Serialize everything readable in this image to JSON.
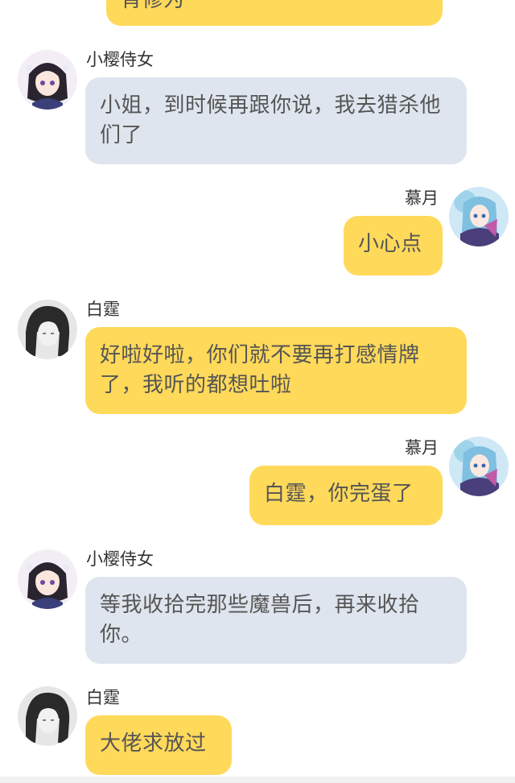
{
  "messages": [
    {
      "sender": "",
      "text": "宵修为"
    },
    {
      "sender": "小樱侍女",
      "text": "小姐，到时候再跟你说，我去猎杀他们了"
    },
    {
      "sender": "慕月",
      "text": "小心点"
    },
    {
      "sender": "白霆",
      "text": "好啦好啦，你们就不要再打感情牌了，我听的都想吐啦"
    },
    {
      "sender": "慕月",
      "text": "白霆，你完蛋了"
    },
    {
      "sender": "小樱侍女",
      "text": "等我收拾完那些魔兽后，再来收拾你。"
    },
    {
      "sender": "白霆",
      "text": "大佬求放过"
    }
  ],
  "colors": {
    "yellow_bubble": "#ffd95a",
    "gray_bubble": "#dfe5ee",
    "text": "#555555",
    "name": "#333333"
  }
}
